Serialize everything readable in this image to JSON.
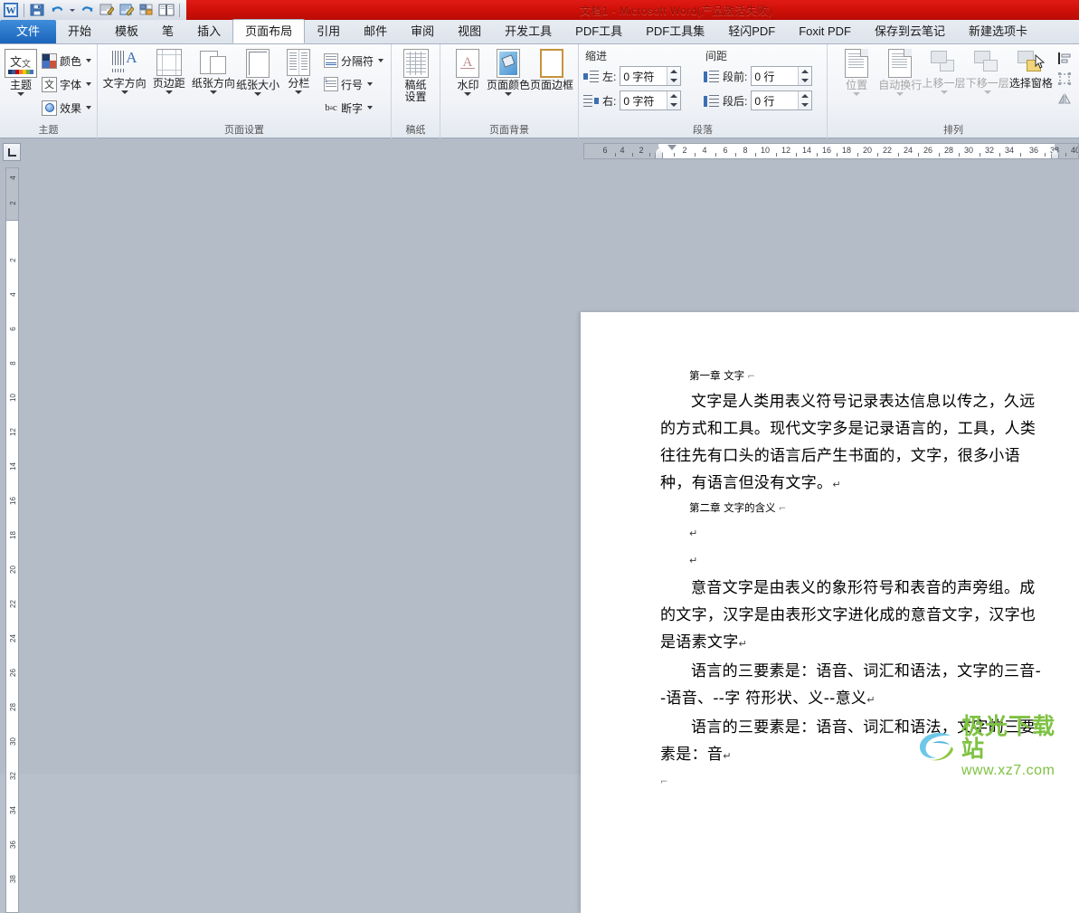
{
  "window": {
    "title": "文档1  -  Microsoft Word(产品激活失败)"
  },
  "quick_access": [
    {
      "name": "word-logo-icon",
      "label": "W"
    },
    {
      "name": "save-icon",
      "label": "保存"
    },
    {
      "name": "undo-icon",
      "label": "撤销"
    },
    {
      "name": "redo-icon",
      "label": "恢复"
    },
    {
      "name": "edit-icon",
      "label": "编辑"
    },
    {
      "name": "screenshot-pen-icon",
      "label": "截图"
    },
    {
      "name": "table-icon",
      "label": "表格"
    },
    {
      "name": "reading-icon",
      "label": "阅读"
    },
    {
      "name": "customize-qat-icon",
      "label": "自定义快速访问工具栏"
    }
  ],
  "tabs": [
    {
      "label": "文件",
      "kind": "file"
    },
    {
      "label": "开始",
      "kind": "normal"
    },
    {
      "label": "模板",
      "kind": "normal"
    },
    {
      "label": "笔",
      "kind": "normal"
    },
    {
      "label": "插入",
      "kind": "normal"
    },
    {
      "label": "页面布局",
      "kind": "active"
    },
    {
      "label": "引用",
      "kind": "normal"
    },
    {
      "label": "邮件",
      "kind": "normal"
    },
    {
      "label": "审阅",
      "kind": "normal"
    },
    {
      "label": "视图",
      "kind": "normal"
    },
    {
      "label": "开发工具",
      "kind": "normal"
    },
    {
      "label": "PDF工具",
      "kind": "normal"
    },
    {
      "label": "PDF工具集",
      "kind": "normal"
    },
    {
      "label": "轻闪PDF",
      "kind": "normal"
    },
    {
      "label": "Foxit PDF",
      "kind": "normal"
    },
    {
      "label": "保存到云笔记",
      "kind": "normal"
    },
    {
      "label": "新建选项卡",
      "kind": "normal"
    }
  ],
  "ribbon": {
    "groups": {
      "themes": {
        "title": "主题",
        "main_button": "主题",
        "items": [
          {
            "label": "颜色",
            "icon": "theme-colors-icon"
          },
          {
            "label": "字体",
            "icon": "theme-fonts-icon"
          },
          {
            "label": "效果",
            "icon": "theme-effects-icon"
          }
        ]
      },
      "page_setup": {
        "title": "页面设置",
        "big_buttons": [
          {
            "label": "文字方向",
            "icon": "text-direction-icon"
          },
          {
            "label": "页边距",
            "icon": "margins-icon"
          },
          {
            "label": "纸张方向",
            "icon": "orientation-icon"
          },
          {
            "label": "纸张大小",
            "icon": "paper-size-icon"
          },
          {
            "label": "分栏",
            "icon": "columns-icon"
          }
        ],
        "small_buttons": [
          {
            "label": "分隔符",
            "icon": "breaks-icon"
          },
          {
            "label": "行号",
            "icon": "line-numbers-icon"
          },
          {
            "label": "断字",
            "icon": "hyphenation-icon"
          }
        ]
      },
      "manuscript": {
        "title": "稿纸",
        "big_buttons": [
          {
            "label": "稿纸\n设置",
            "label_line1": "稿纸",
            "label_line2": "设置",
            "icon": "manuscript-settings-icon"
          }
        ]
      },
      "page_background": {
        "title": "页面背景",
        "big_buttons": [
          {
            "label": "水印",
            "icon": "watermark-icon"
          },
          {
            "label": "页面颜色",
            "icon": "page-color-icon"
          },
          {
            "label": "页面边框",
            "icon": "page-borders-icon"
          }
        ]
      },
      "paragraph": {
        "title": "段落",
        "indent_title": "缩进",
        "spacing_title": "间距",
        "fields": [
          {
            "label": "左:",
            "value": "0 字符",
            "name": "indent-left-field"
          },
          {
            "label": "右:",
            "value": "0 字符",
            "name": "indent-right-field"
          },
          {
            "label": "段前:",
            "value": "0 行",
            "name": "spacing-before-field"
          },
          {
            "label": "段后:",
            "value": "0 行",
            "name": "spacing-after-field"
          }
        ]
      },
      "arrange": {
        "title": "排列",
        "big_buttons": [
          {
            "label": "位置",
            "icon": "position-icon",
            "disabled": true
          },
          {
            "label": "自动换行",
            "icon": "wrap-text-icon",
            "disabled": true
          },
          {
            "label": "上移一层",
            "icon": "bring-forward-icon",
            "disabled": true
          },
          {
            "label": "下移一层",
            "icon": "send-backward-icon",
            "disabled": true
          },
          {
            "label": "选择窗格",
            "icon": "selection-pane-icon",
            "disabled": false
          }
        ],
        "edge_icons": [
          {
            "name": "align-icon"
          },
          {
            "name": "group-icon"
          },
          {
            "name": "rotate-icon"
          }
        ]
      }
    }
  },
  "rulers": {
    "horizontal_numbers": [
      "6",
      "4",
      "2",
      "2",
      "4",
      "6",
      "8",
      "10",
      "12",
      "14",
      "16",
      "18",
      "20",
      "22",
      "24",
      "26",
      "28",
      "30",
      "32",
      "34",
      "36",
      "38",
      "40"
    ],
    "vertical_numbers": [
      "4",
      "2",
      "2",
      "4",
      "6",
      "8",
      "10",
      "12",
      "14",
      "16",
      "18",
      "20",
      "22",
      "24",
      "26",
      "28",
      "30",
      "32",
      "34",
      "36",
      "38"
    ],
    "tab_stop_indicator": "L"
  },
  "document": {
    "paragraphs": [
      {
        "type": "heading",
        "text": "第一章 文字"
      },
      {
        "type": "body",
        "text": "文字是人类用表义符号记录表达信息以传之，久远的方式和工具。现代文字多是记录语言的，工具，人类往往先有口头的语言后产生书面的，文字，很多小语种，有语言但没有文字。"
      },
      {
        "type": "heading",
        "text": "第二章 文字的含义"
      },
      {
        "type": "empty",
        "text": ""
      },
      {
        "type": "empty",
        "text": ""
      },
      {
        "type": "body",
        "text": "意音文字是由表义的象形符号和表音的声旁组。成的文字，汉字是由表形文字进化成的意音文字，汉字也是语素文字"
      },
      {
        "type": "body",
        "text": "语言的三要素是：语音、词汇和语法，文字的三音--语音、--字 符形状、义--意义"
      },
      {
        "type": "body",
        "text": "语言的三要素是：语音、词汇和语法，文字的三要素是：音"
      }
    ],
    "pilcrow": "↵"
  },
  "watermark": {
    "title": "极光下载站",
    "url": "www.xz7.com",
    "color": "#7ec242"
  },
  "colors": {
    "title_bar_red": "#d01008",
    "tab_active_blue": "#1a64bb",
    "workspace_gray": "#b4bcc8",
    "ribbon_light": "#f1f3f7"
  }
}
